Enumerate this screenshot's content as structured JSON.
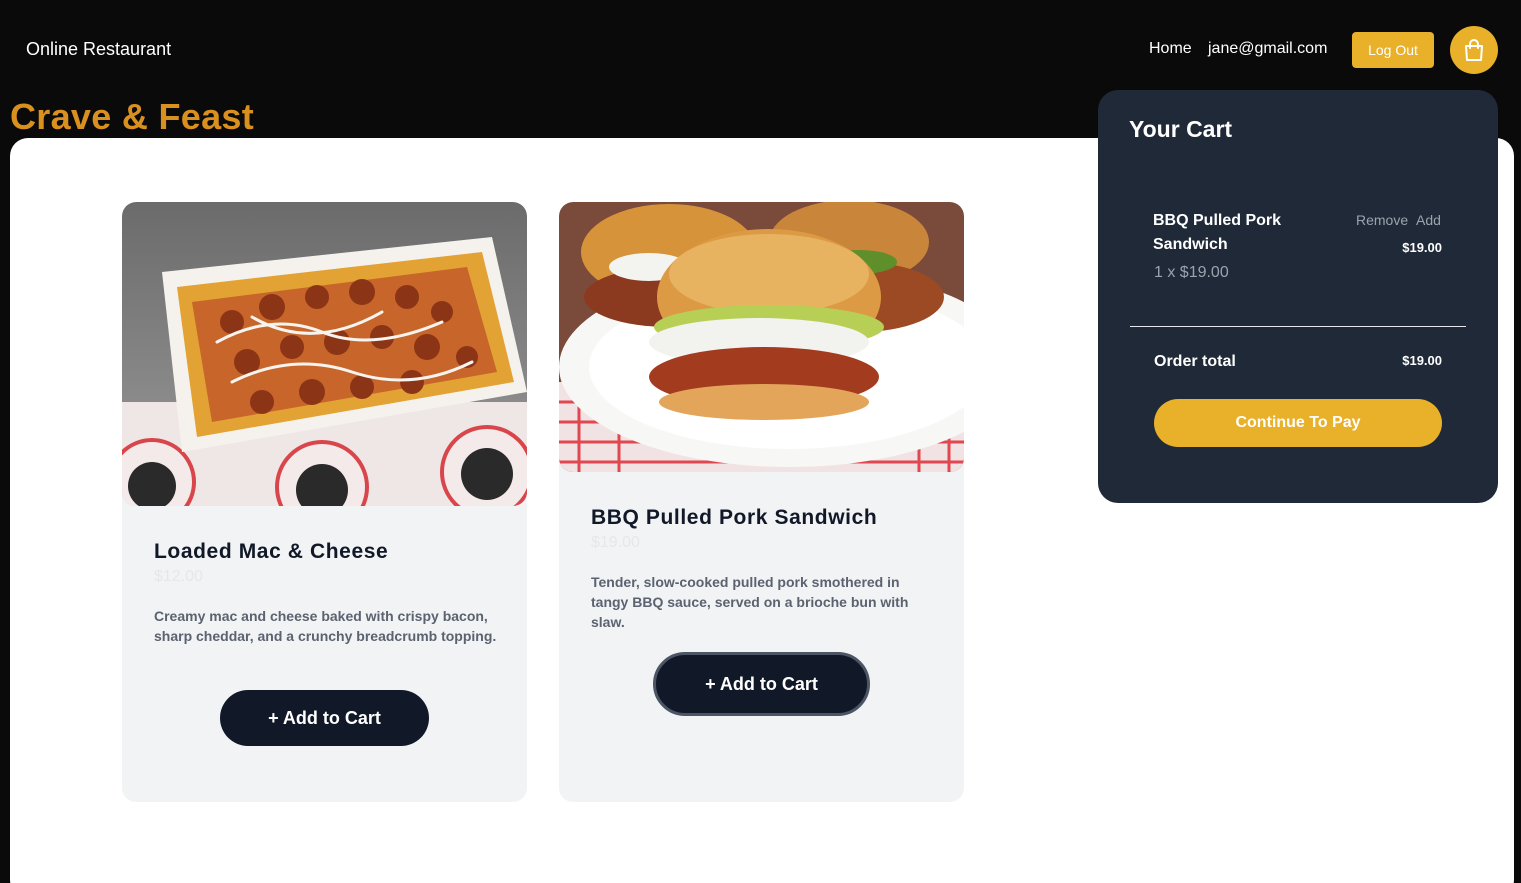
{
  "header": {
    "brand": "Online Restaurant",
    "nav_home": "Home",
    "user_email": "jane@gmail.com",
    "logout_label": "Log Out",
    "cart_icon": "shopping-bag-icon"
  },
  "headline": "Crave & Feast",
  "products": [
    {
      "title": "Loaded Mac & Cheese",
      "price": "$12.00",
      "description": "Creamy mac and cheese baked with crispy bacon, sharp cheddar, and a crunchy breadcrumb topping.",
      "button_label": "+ Add to Cart"
    },
    {
      "title": "BBQ Pulled Pork Sandwich",
      "price": "$19.00",
      "description": "Tender, slow-cooked pulled pork smothered in tangy BBQ sauce, served on a brioche bun with slaw.",
      "button_label": "+ Add to Cart"
    }
  ],
  "cart": {
    "title": "Your Cart",
    "items": [
      {
        "name": "BBQ Pulled Pork Sandwich",
        "quantity_line": "1 x $19.00",
        "remove_label": "Remove",
        "add_label": "Add",
        "line_total": "$19.00"
      }
    ],
    "order_total_label": "Order total",
    "order_total_value": "$19.00",
    "pay_label": "Continue To Pay"
  },
  "colors": {
    "accent": "#e9b02a",
    "headline": "#d9901e",
    "cart_panel": "#1f2937",
    "button_dark": "#111827"
  }
}
